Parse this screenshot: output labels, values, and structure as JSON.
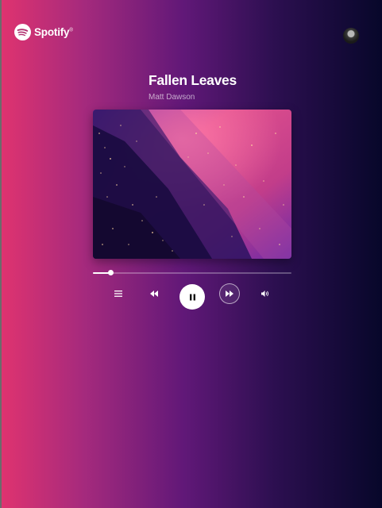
{
  "brand": {
    "name": "Spotify",
    "mark": "®",
    "accent": "#ffffff"
  },
  "track": {
    "title": "Fallen Leaves",
    "artist": "Matt Dawson"
  },
  "player": {
    "progress": 0.09,
    "state": "playing"
  },
  "controls": {
    "queue_icon": "queue-list-icon",
    "prev_icon": "rewind-icon",
    "play_icon": "pause-icon",
    "next_icon": "fast-forward-icon",
    "volume_icon": "volume-icon"
  },
  "colors": {
    "gradient_left": "#e0336f",
    "gradient_mid": "#611878",
    "gradient_right": "#07072a"
  }
}
